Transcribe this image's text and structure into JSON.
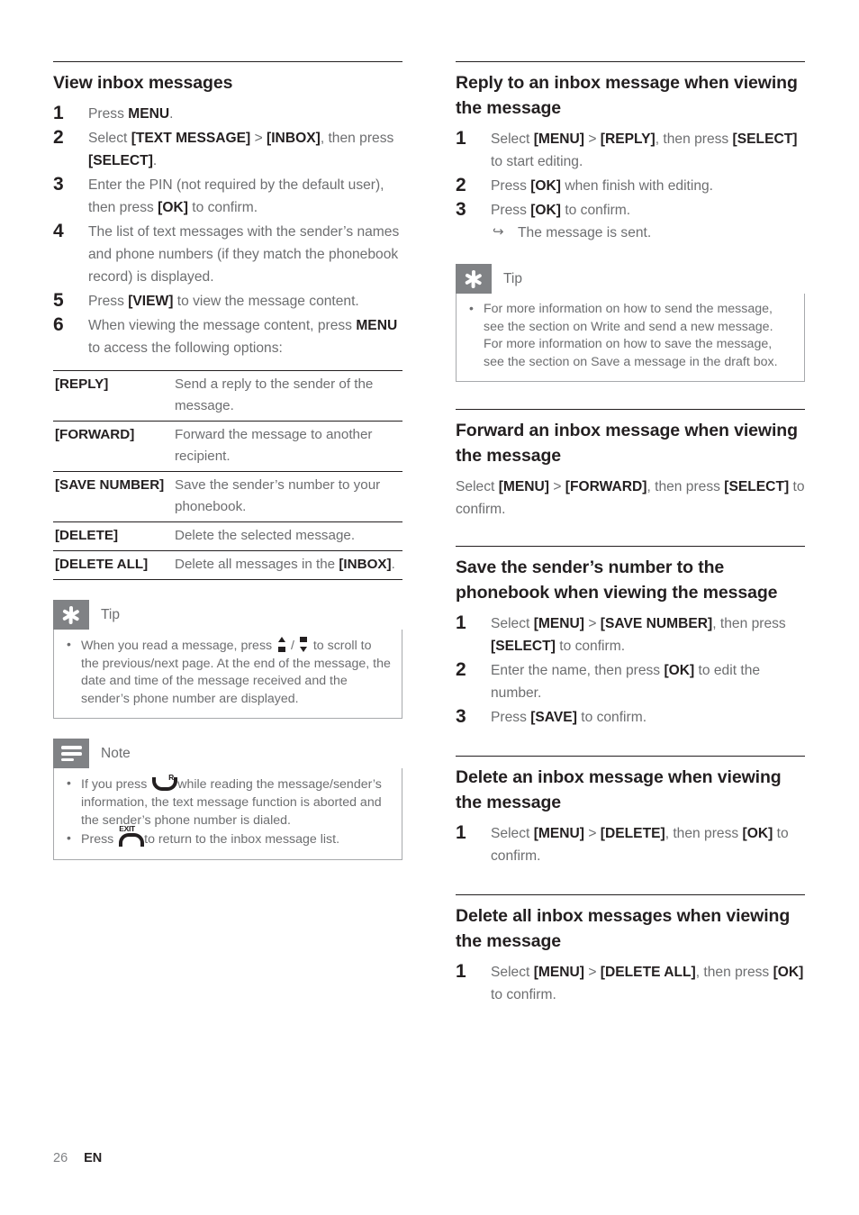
{
  "document": {
    "footer": {
      "page_number": "26",
      "language": "EN"
    },
    "text_color": "#6d6e70",
    "heading_color": "#231f20",
    "callout_icon_bg": "#808285"
  },
  "left_column": {
    "section_view_inbox": {
      "heading": "View inbox messages",
      "steps": [
        {
          "num": "1",
          "parts": [
            {
              "t": "Press "
            },
            {
              "t": "MENU",
              "b": true
            },
            {
              "t": "."
            }
          ]
        },
        {
          "num": "2",
          "parts": [
            {
              "t": "Select "
            },
            {
              "t": "[TEXT MESSAGE]",
              "b": true
            },
            {
              "t": " > "
            },
            {
              "t": "[INBOX]",
              "b": true
            },
            {
              "t": ", then press "
            },
            {
              "t": "[SELECT]",
              "b": true
            },
            {
              "t": "."
            }
          ]
        },
        {
          "num": "3",
          "parts": [
            {
              "t": "Enter the PIN (not required by the default user), then press "
            },
            {
              "t": "[OK]",
              "b": true
            },
            {
              "t": " to confirm."
            }
          ]
        },
        {
          "num": "4",
          "parts": [
            {
              "t": "The list of text messages with the sender’s names and phone numbers (if they match the phonebook record) is displayed."
            }
          ]
        },
        {
          "num": "5",
          "parts": [
            {
              "t": "Press "
            },
            {
              "t": "[VIEW]",
              "b": true
            },
            {
              "t": " to view the message content."
            }
          ]
        },
        {
          "num": "6",
          "parts": [
            {
              "t": "When viewing the message content, press "
            },
            {
              "t": "MENU",
              "b": true
            },
            {
              "t": " to access the following options:"
            }
          ]
        }
      ],
      "options_table": {
        "rows": [
          {
            "key": "[REPLY]",
            "value": "Send a reply to the sender of the message."
          },
          {
            "key": "[FORWARD]",
            "value": "Forward the message to another recipient."
          },
          {
            "key": "[SAVE NUMBER]",
            "value": "Save the sender’s number to your phonebook."
          },
          {
            "key": "[DELETE]",
            "value": "Delete the selected message."
          },
          {
            "key": "[DELETE ALL]",
            "value_parts": [
              {
                "t": "Delete all messages in the "
              },
              {
                "t": "[INBOX]",
                "b": true
              },
              {
                "t": "."
              }
            ]
          }
        ]
      }
    },
    "tip_callout": {
      "icon": "asterisk-icon",
      "label": "Tip",
      "bullets": [
        {
          "parts": [
            {
              "t": "When you read a message, press "
            },
            {
              "icon": "scroll-up-key-icon"
            },
            {
              "t": " / "
            },
            {
              "icon": "scroll-down-key-icon"
            },
            {
              "t": " to scroll to the previous/next page. At the end of the message, the date and time of the message received and the sender’s phone number are displayed."
            }
          ]
        }
      ]
    },
    "note_callout": {
      "icon": "lines-icon",
      "label": "Note",
      "bullets": [
        {
          "parts": [
            {
              "t": "If you press "
            },
            {
              "icon": "talk-handset-icon",
              "tag": "R"
            },
            {
              "t": " while reading the message/sender’s information, the text message function is aborted and the sender’s phone number is dialed."
            }
          ]
        },
        {
          "parts": [
            {
              "t": "Press "
            },
            {
              "icon": "exit-handset-icon",
              "tag": "EXIT"
            },
            {
              "t": " to return to the inbox message list."
            }
          ]
        }
      ]
    }
  },
  "right_column": {
    "section_reply": {
      "heading": "Reply to an inbox message when viewing the message",
      "steps": [
        {
          "num": "1",
          "parts": [
            {
              "t": "Select "
            },
            {
              "t": "[MENU]",
              "b": true
            },
            {
              "t": " > "
            },
            {
              "t": "[REPLY]",
              "b": true
            },
            {
              "t": ", then press "
            },
            {
              "t": "[SELECT]",
              "b": true
            },
            {
              "t": " to start editing."
            }
          ]
        },
        {
          "num": "2",
          "parts": [
            {
              "t": "Press "
            },
            {
              "t": "[OK]",
              "b": true
            },
            {
              "t": " when finish with editing."
            }
          ]
        },
        {
          "num": "3",
          "parts": [
            {
              "t": "Press "
            },
            {
              "t": "[OK]",
              "b": true
            },
            {
              "t": " to confirm."
            }
          ],
          "result": "The message is sent."
        }
      ]
    },
    "tip_callout": {
      "icon": "asterisk-icon",
      "label": "Tip",
      "bullets": [
        {
          "parts": [
            {
              "t": "For more information on how to send the message, see the section on Write and send a new message. For more information on how to save the message, see the section on Save a message in the draft box."
            }
          ]
        }
      ]
    },
    "section_forward": {
      "heading": "Forward an inbox message when viewing the message",
      "paragraph_parts": [
        {
          "t": "Select "
        },
        {
          "t": "[MENU]",
          "b": true
        },
        {
          "t": " > "
        },
        {
          "t": "[FORWARD]",
          "b": true
        },
        {
          "t": ", then press "
        },
        {
          "t": "[SELECT]",
          "b": true
        },
        {
          "t": " to confirm."
        }
      ]
    },
    "section_save_number": {
      "heading": "Save the sender’s number to the phonebook when viewing the message",
      "steps": [
        {
          "num": "1",
          "parts": [
            {
              "t": "Select "
            },
            {
              "t": "[MENU]",
              "b": true
            },
            {
              "t": " > "
            },
            {
              "t": "[SAVE NUMBER]",
              "b": true
            },
            {
              "t": ", then press "
            },
            {
              "t": "[SELECT]",
              "b": true
            },
            {
              "t": " to confirm."
            }
          ]
        },
        {
          "num": "2",
          "parts": [
            {
              "t": "Enter the name, then press "
            },
            {
              "t": "[OK]",
              "b": true
            },
            {
              "t": " to edit the number."
            }
          ]
        },
        {
          "num": "3",
          "parts": [
            {
              "t": "Press "
            },
            {
              "t": "[SAVE]",
              "b": true
            },
            {
              "t": " to confirm."
            }
          ]
        }
      ]
    },
    "section_delete": {
      "heading": "Delete an inbox message when viewing the message",
      "steps": [
        {
          "num": "1",
          "parts": [
            {
              "t": "Select "
            },
            {
              "t": "[MENU]",
              "b": true
            },
            {
              "t": " > "
            },
            {
              "t": "[DELETE]",
              "b": true
            },
            {
              "t": ", then press "
            },
            {
              "t": "[OK]",
              "b": true
            },
            {
              "t": " to confirm."
            }
          ]
        }
      ]
    },
    "section_delete_all": {
      "heading": "Delete all inbox messages when viewing the message",
      "steps": [
        {
          "num": "1",
          "parts": [
            {
              "t": "Select "
            },
            {
              "t": "[MENU]",
              "b": true
            },
            {
              "t": " > "
            },
            {
              "t": "[DELETE ALL]",
              "b": true
            },
            {
              "t": ", then press "
            },
            {
              "t": "[OK]",
              "b": true
            },
            {
              "t": " to confirm."
            }
          ]
        }
      ]
    }
  }
}
